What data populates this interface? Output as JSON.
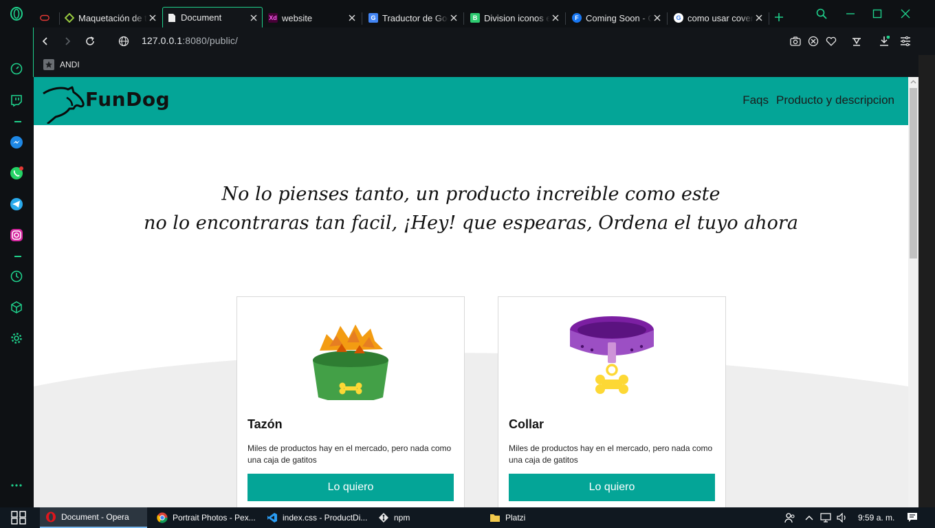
{
  "browser": {
    "tabs": [
      {
        "label": "Maquetación de t",
        "icon": "gamepad-icon"
      },
      {
        "label": "Maquetación de t",
        "icon": "platzi-icon"
      },
      {
        "label": "Document",
        "icon": "document-icon",
        "active": true
      },
      {
        "label": "website",
        "icon": "xd-icon"
      },
      {
        "label": "Traductor de Goo",
        "icon": "google-translate-icon"
      },
      {
        "label": "Division iconos e",
        "icon": "bootstrap-icon"
      },
      {
        "label": "Coming Soon - G",
        "icon": "f-logo-icon"
      },
      {
        "label": "como usar cover",
        "icon": "google-icon"
      }
    ],
    "url_host": "127.0.0.1",
    "url_rest": ":8080/public/",
    "bookmark": "ANDI"
  },
  "site": {
    "logo": "FunDog",
    "nav": [
      "Faqs",
      "Producto y descripcion"
    ],
    "hero_line1": "No lo pienses tanto, un producto increible como este",
    "hero_line2": "no lo encontraras tan facil, ¡Hey! que espearas, Ordena el tuyo ahora",
    "products": [
      {
        "title": "Tazón",
        "desc": "Miles de productos hay en el mercado, pero nada como una caja de gatitos",
        "button": "Lo quiero",
        "icon": "dog-bowl-icon"
      },
      {
        "title": "Collar",
        "desc": "Miles de productos hay en el mercado, pero nada como una caja de gatitos",
        "button": "Lo quiero",
        "icon": "dog-collar-icon"
      }
    ]
  },
  "taskbar": {
    "items": [
      {
        "label": "Document - Opera",
        "icon": "opera-icon"
      },
      {
        "label": "Portrait Photos - Pex...",
        "icon": "chrome-icon"
      },
      {
        "label": "index.css - ProductDi...",
        "icon": "vscode-icon"
      },
      {
        "label": "npm",
        "icon": "git-icon"
      },
      {
        "label": "Platzi",
        "icon": "folder-icon"
      }
    ],
    "clock": "9:59 a. m."
  },
  "colors": {
    "brand": "#04a597",
    "opera_accent": "#1fd18c"
  }
}
